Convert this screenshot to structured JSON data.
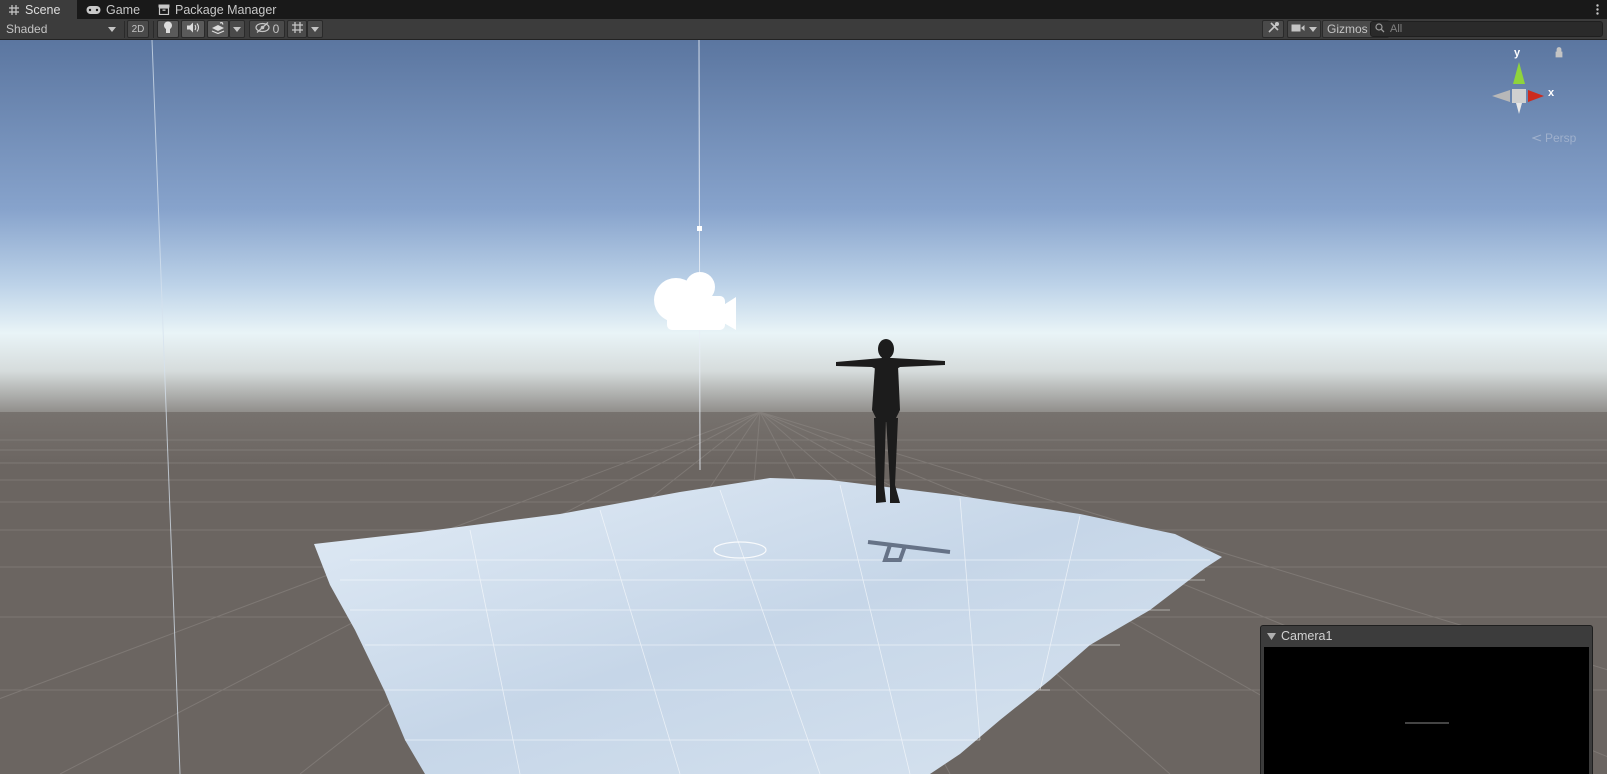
{
  "tabs": [
    {
      "label": "Scene",
      "icon": "grid-icon",
      "active": true
    },
    {
      "label": "Game",
      "icon": "gamepad-icon",
      "active": false
    },
    {
      "label": "Package Manager",
      "icon": "package-icon",
      "active": false
    }
  ],
  "toolbar": {
    "draw_mode": "Shaded",
    "mode_2d": "2D",
    "hidden_count": "0",
    "gizmos": "Gizmos",
    "search_placeholder": "All"
  },
  "orientation_gizmo": {
    "y_label": "y",
    "x_label": "x",
    "projection": "Persp"
  },
  "camera_preview": {
    "title": "Camera1"
  },
  "colors": {
    "toolbar_bg": "#3c3c3c",
    "tab_bg": "#191919",
    "sky_top": "#5b76a0",
    "horizon": "#e8f2f6",
    "ground": "#6b6561",
    "terrain": "#cfdfee",
    "axis_y": "#8fd43c",
    "axis_x": "#cc2b1e"
  }
}
